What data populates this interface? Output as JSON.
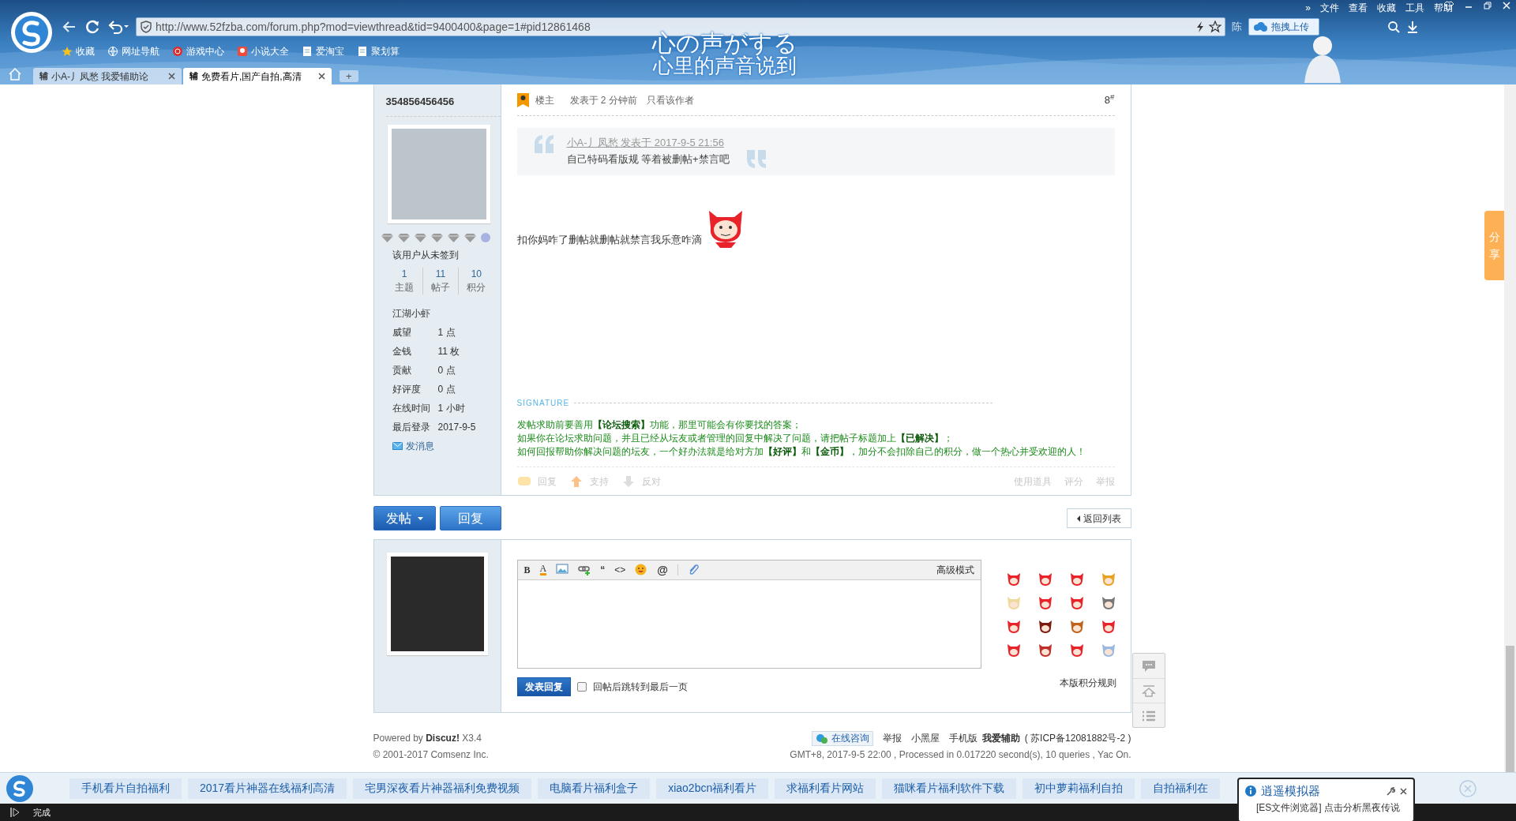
{
  "browser": {
    "address": "http://www.52fzba.com/forum.php?mod=viewthread&tid=9400400&page=1#pid12861468",
    "menu": [
      "»",
      "文件",
      "查看",
      "收藏",
      "工具",
      "帮助"
    ],
    "user_name": "陈",
    "upload_button": "拖拽上传",
    "banner_lines": [
      "心の声がする",
      "心里的声音说到"
    ],
    "bookmarks": [
      {
        "label": "收藏",
        "kind": "star"
      },
      {
        "label": "网址导航",
        "kind": "globe"
      },
      {
        "label": "游戏中心",
        "kind": "game"
      },
      {
        "label": "小说大全",
        "kind": "novel"
      },
      {
        "label": "爱淘宝",
        "kind": "page"
      },
      {
        "label": "聚划算",
        "kind": "page"
      }
    ],
    "tabs": [
      {
        "favicon": "辅",
        "label": "小A-丿凤愁 我爱辅助论",
        "selected": false
      },
      {
        "favicon": "辅",
        "label": "免费看片,国产自拍,高清",
        "selected": true
      }
    ],
    "new_tab": "+"
  },
  "author": {
    "name": "354856456456",
    "sign_in": "该用户从未签到",
    "stats": [
      {
        "value": "1",
        "label": "主题"
      },
      {
        "value": "11",
        "label": "帖子"
      },
      {
        "value": "10",
        "label": "积分"
      }
    ],
    "rank": "江湖小虾",
    "fields": [
      {
        "label": "威望",
        "value": "1 点"
      },
      {
        "label": "金钱",
        "value": "11 枚"
      },
      {
        "label": "贡献",
        "value": "0 点"
      },
      {
        "label": "好评度",
        "value": "0 点"
      },
      {
        "label": "在线时间",
        "value": "1 小时"
      },
      {
        "label": "最后登录",
        "value": "2017-9-5"
      }
    ],
    "message_link": "发消息"
  },
  "post": {
    "role": "楼主",
    "time": "发表于 2 分钟前",
    "only_author": "只看该作者",
    "floor": "8",
    "floor_mark": "#",
    "quote": {
      "source": "小A-丿凤愁 发表于 2017-9-5 21:56",
      "text": "自己特码看版规 等着被删帖+禁言吧"
    },
    "body": "扣你妈咋了删帖就删帖就禁言我乐意咋滴",
    "signature_label": "SIGNATURE",
    "signature": [
      "发帖求助前要善用**【论坛搜索】**功能，那里可能会有你要找的答案；",
      "如果你在论坛求助问题，并且已经从坛友或者管理的回复中解决了问题，请把帖子标题加上**【已解决】**；",
      "如何回报帮助你解决问题的坛友，一个好办法就是给对方加**【好评】**和**【金币】**，加分不会扣除自己的积分，做一个热心并受欢迎的人！"
    ],
    "actions_left": [
      {
        "label": "回复",
        "kind": "reply"
      },
      {
        "label": "支持",
        "kind": "up"
      },
      {
        "label": "反对",
        "kind": "down"
      }
    ],
    "actions_right": [
      "使用道具",
      "评分",
      "举报"
    ]
  },
  "buttons": {
    "new_post": "发帖",
    "reply": "回复",
    "back": "返回列表"
  },
  "editor": {
    "toolbar": [
      {
        "kind": "bold",
        "glyph": "B"
      },
      {
        "kind": "color",
        "glyph": "A"
      },
      {
        "kind": "image"
      },
      {
        "kind": "link"
      },
      {
        "kind": "quote",
        "glyph": "“"
      },
      {
        "kind": "code",
        "glyph": "<>"
      },
      {
        "kind": "smiley"
      },
      {
        "kind": "at",
        "glyph": "@"
      },
      {
        "kind": "attach"
      }
    ],
    "mode": "高级模式",
    "submit": "发表回复",
    "jump_label": "回帖后跳转到最后一页",
    "jump_checked": false,
    "rules_link": "本版积分规则"
  },
  "share_tab": "分享",
  "footer": {
    "powered": "Powered by **Discuz!** X3.4",
    "copyright": "© 2001-2017 Comsenz Inc.",
    "consult": "在线咨询",
    "links": [
      "举报",
      "小黑屋",
      "手机版"
    ],
    "site": "我爱辅助",
    "icp": "( 苏ICP备12081882号-2 )",
    "stats": "GMT+8, 2017-9-5 22:00 , Processed in 0.017220 second(s), 10 queries , Yac On."
  },
  "bottom_bar": [
    "手机看片自拍福利",
    "2017看片神器在线福利高清",
    "宅男深夜看片神器福利免费视频",
    "电脑看片福利盒子",
    "xiao2bcn福利看片",
    "求福利看片网站",
    "猫咪看片福利软件下载",
    "初中萝莉福利自拍",
    "自拍福利在"
  ],
  "notification": {
    "title": "逍遥模拟器",
    "text": "[ES文件浏览器] 点击分析黑夜传说"
  },
  "status_bar": {
    "text": "完成"
  }
}
